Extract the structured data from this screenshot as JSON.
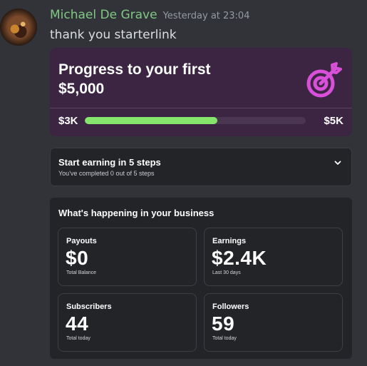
{
  "message": {
    "author": "Michael De Grave",
    "timestamp": "Yesterday at 23:04",
    "text": "thank you starterlink"
  },
  "progress": {
    "title": "Progress to your first $5,000",
    "start_label": "$3K",
    "end_label": "$5K",
    "fill_fraction": 0.6,
    "icon": "target-icon",
    "accent_color": "#86e66b",
    "icon_color": "#d84fd8"
  },
  "steps": {
    "title": "Start earning in 5 steps",
    "subtitle": "You've completed 0 out of 5 steps"
  },
  "business": {
    "title": "What's happening in your business",
    "stats": [
      {
        "label": "Payouts",
        "value": "$0",
        "sub": "Total Balance"
      },
      {
        "label": "Earnings",
        "value": "$2.4K",
        "sub": "Last 30 days"
      },
      {
        "label": "Subscribers",
        "value": "44",
        "sub": "Total today"
      },
      {
        "label": "Followers",
        "value": "59",
        "sub": "Total today"
      }
    ]
  }
}
